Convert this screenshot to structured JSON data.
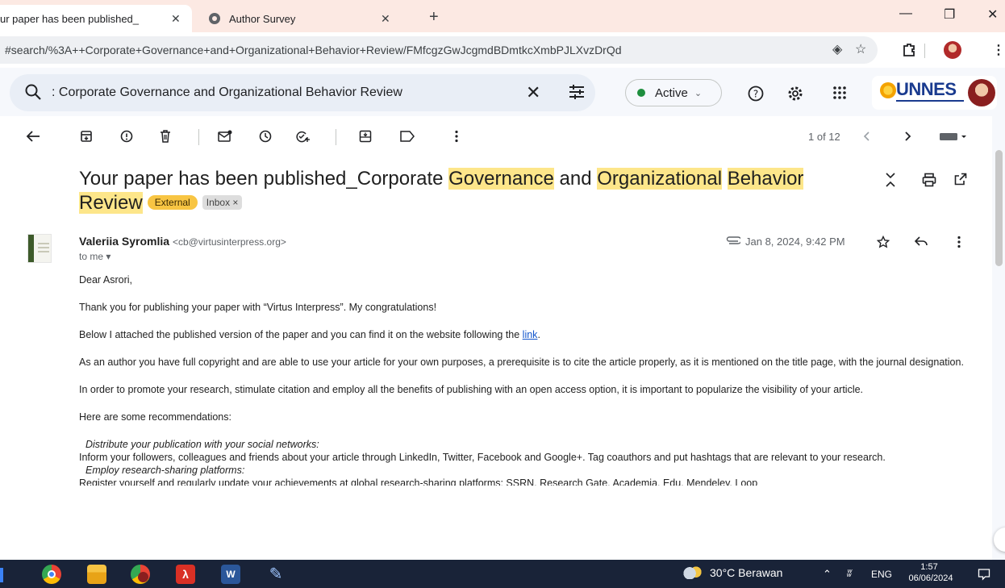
{
  "browser": {
    "tabs": [
      {
        "title": "ur paper has been published_",
        "active": true
      },
      {
        "title": "Author Survey",
        "active": false
      }
    ],
    "url": "#search/%3A++Corporate+Governance+and+Organizational+Behavior+Review/FMfcgzGwJcgmdBDmtkcXmbPJLXvzDrQd"
  },
  "gmail": {
    "search": {
      "prefix": ": ",
      "query": "Corporate Governance and Organizational Behavior Review"
    },
    "status": "Active",
    "brand": "UNNES",
    "pager": "1 of 12"
  },
  "email": {
    "subject_parts": [
      {
        "text": "Your paper has been published_Corporate ",
        "hl": false
      },
      {
        "text": "Governance",
        "hl": true
      },
      {
        "text": " and ",
        "hl": false
      },
      {
        "text": "Organizational",
        "hl": true
      },
      {
        "text": " ",
        "hl": false
      },
      {
        "text": "Behavior",
        "hl": true
      },
      {
        "text": " ",
        "hl": false
      },
      {
        "text": "Review",
        "hl": true
      }
    ],
    "labels": {
      "external": "External",
      "inbox": "Inbox ×"
    },
    "sender": {
      "name": "Valeriia Syromlia",
      "email": "<cb@virtusinterpress.org>"
    },
    "to": "to me",
    "date": "Jan 8, 2024, 9:42 PM",
    "greeting": "Dear Asrori,",
    "p1": "Thank you for publishing your paper with “Virtus Interpress”. My congratulations!",
    "p2_text": "Below I attached the published version of the paper and you can find it on the website following the ",
    "p2_link": "link",
    "p2_end": ".",
    "p3": "As an author you have full copyright and are able to use your article for your own purposes, a prerequisite is to cite the article properly, as it is mentioned on the title page, with the journal designation.",
    "p4": "In order to promote your research, stimulate citation and employ all the benefits of publishing with an open access option, it is important to popularize the visibility of your article.",
    "p5": "Here are some recommendations:",
    "s1_title": "Distribute your publication with your social networks:",
    "s1_text": "Inform your followers, colleagues and friends about your article through LinkedIn, Twitter, Facebook and Google+. Tag coauthors and put hashtags that are relevant to your research.",
    "s2_title": "Employ research-sharing platforms:",
    "s2_text": "Register yourself and regularly update your achievements at global research-sharing platforms: SSRN, Research Gate, Academia. Edu, Mendeley, Loop"
  },
  "taskbar": {
    "weather": "30°C  Berawan",
    "lang": "ENG",
    "time": "1:57",
    "date": "06/06/2024"
  },
  "colors": {
    "highlight": "#fde68a",
    "external_label": "#f8c543",
    "active_dot": "#1e8e3e",
    "taskbar": "#192338"
  }
}
